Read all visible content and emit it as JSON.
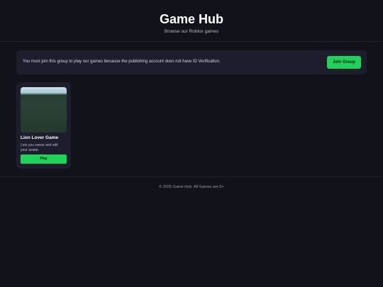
{
  "header": {
    "title": "Game Hub",
    "subtitle": "Browse our Roblox games"
  },
  "notice": {
    "message": "You must join this group to play our games because the publishing account does not have ID Verification.",
    "button_label": "Join Group"
  },
  "games": [
    {
      "name": "Lion Lover Game",
      "description": "Lets you swear and edit your avatar.",
      "play_label": "Play"
    }
  ],
  "footer": {
    "text": "© 2025 Game Hub. All Games are 5+"
  },
  "colors": {
    "background": "#12121a",
    "card": "#1d1d2e",
    "accent_green": "#1fd35a"
  }
}
